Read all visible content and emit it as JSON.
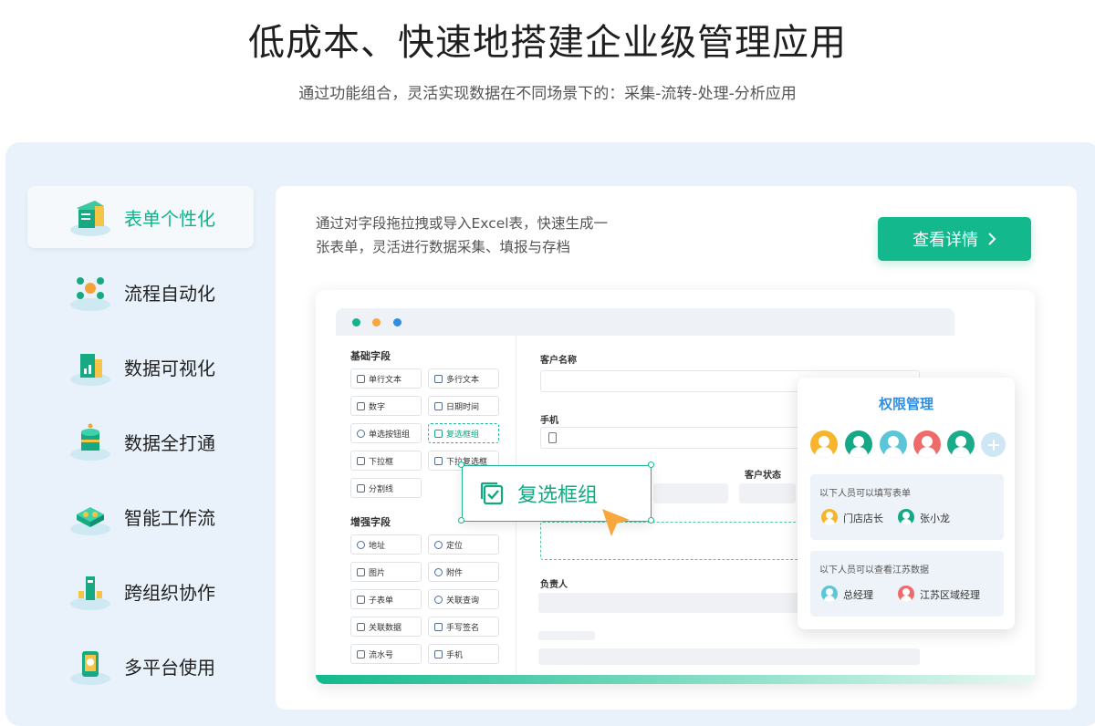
{
  "hero": {
    "title": "低成本、快速地搭建企业级管理应用",
    "subtitle": "通过功能组合，灵活实现数据在不同场景下的：采集-流转-处理-分析应用"
  },
  "nav": {
    "items": [
      {
        "label": "表单个性化",
        "icon": "form-icon",
        "active": true
      },
      {
        "label": "流程自动化",
        "icon": "workflow-icon"
      },
      {
        "label": "数据可视化",
        "icon": "chart-icon"
      },
      {
        "label": "数据全打通",
        "icon": "database-icon"
      },
      {
        "label": "智能工作流",
        "icon": "smart-flow-icon"
      },
      {
        "label": "跨组织协作",
        "icon": "collaboration-icon"
      },
      {
        "label": "多平台使用",
        "icon": "multi-platform-icon"
      }
    ]
  },
  "card": {
    "description_line1": "通过对字段拖拉拽或导入Excel表，快速生成一",
    "description_line2": "张表单，灵活进行数据采集、填报与存档",
    "detail_button": "查看详情",
    "detail_button_icon": "chevron-right-icon"
  },
  "mock": {
    "window_dots": [
      "#16b38a",
      "#f7a73b",
      "#2f8ee0"
    ],
    "basic_section": "基础字段",
    "basic_fields": [
      "单行文本",
      "多行文本",
      "数字",
      "日期时间",
      "单选按钮组",
      "复选框组",
      "下拉框",
      "下拉复选框",
      "分割线"
    ],
    "advanced_section": "增强字段",
    "advanced_fields": [
      "地址",
      "定位",
      "图片",
      "附件",
      "子表单",
      "关联查询",
      "关联数据",
      "手写签名",
      "流水号",
      "手机"
    ],
    "form": {
      "customer_name_label": "客户名称",
      "phone_label": "手机",
      "status_label": "客户状态",
      "owner_label": "负责人"
    },
    "drag_item": "复选框组"
  },
  "permission": {
    "title": "权限管理",
    "avatar_colors": [
      "#f6b52c",
      "#14a886",
      "#5bc6d8",
      "#ef6b6b",
      "#19ab8a"
    ],
    "add_icon": "plus-icon",
    "fill_note": "以下人员可以填写表单",
    "fill_people": [
      {
        "name": "门店店长",
        "color": "#f6b52c"
      },
      {
        "name": "张小龙",
        "color": "#14a886"
      }
    ],
    "view_note": "以下人员可以查看江苏数据",
    "view_people": [
      {
        "name": "总经理",
        "color": "#5bc6d8"
      },
      {
        "name": "江苏区域经理",
        "color": "#ef6b6b"
      }
    ]
  }
}
